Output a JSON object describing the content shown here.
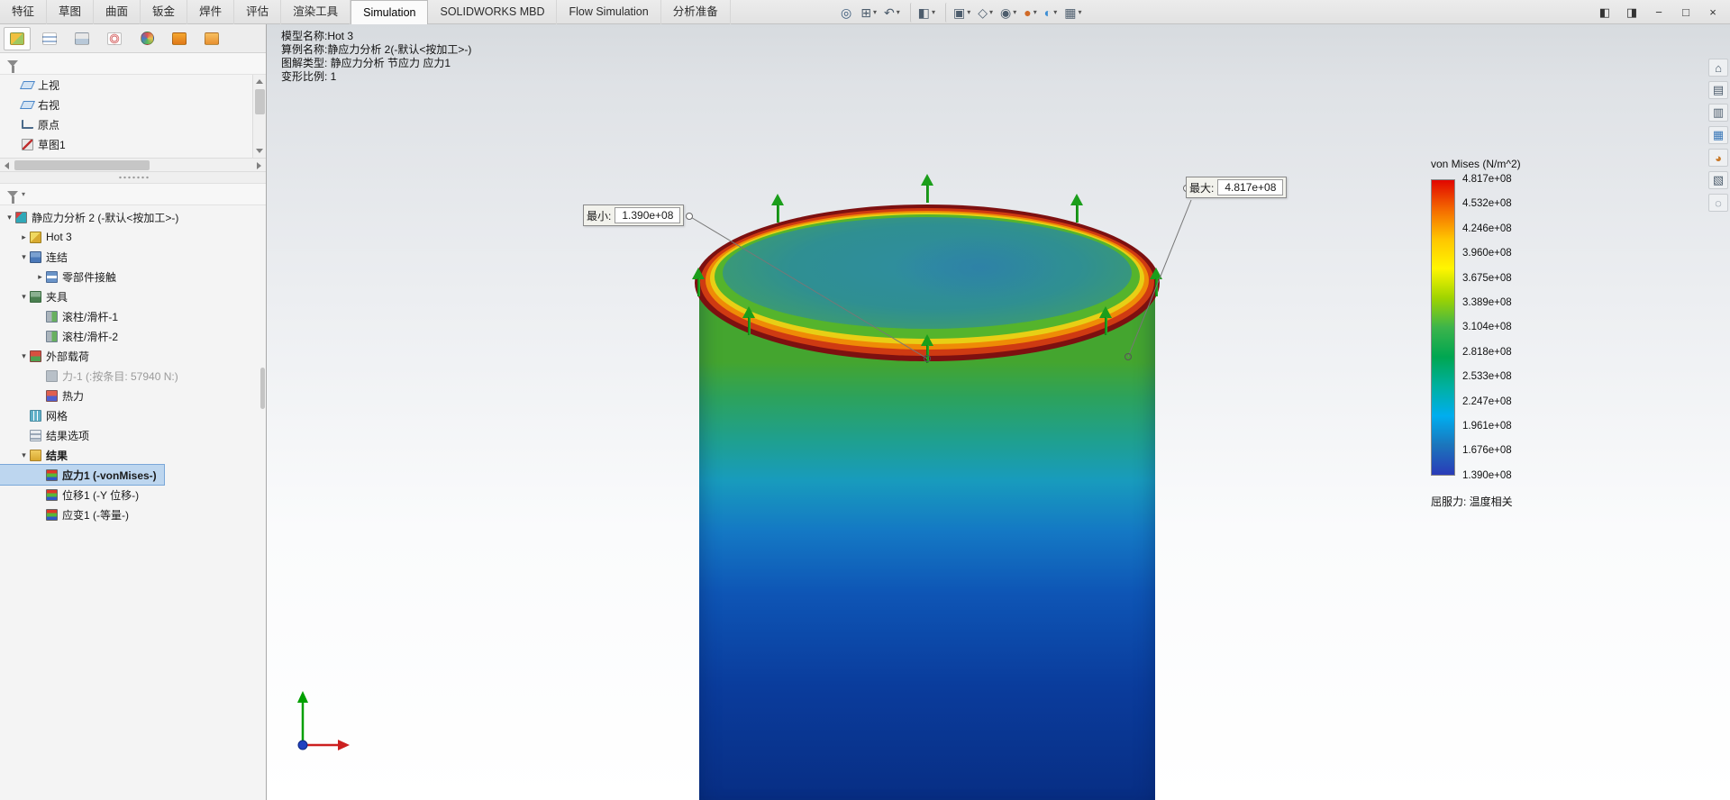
{
  "window": {
    "controls": [
      {
        "name": "task-pane-collapse-icon",
        "glyph": "◧"
      },
      {
        "name": "task-pane-expand-icon",
        "glyph": "◨"
      },
      {
        "name": "minimize-button",
        "glyph": "−"
      },
      {
        "name": "maximize-button",
        "glyph": "□"
      },
      {
        "name": "close-button",
        "glyph": "×"
      }
    ]
  },
  "menu": {
    "tabs": [
      {
        "label": "特征",
        "active": false
      },
      {
        "label": "草图",
        "active": false
      },
      {
        "label": "曲面",
        "active": false
      },
      {
        "label": "钣金",
        "active": false
      },
      {
        "label": "焊件",
        "active": false
      },
      {
        "label": "评估",
        "active": false
      },
      {
        "label": "渲染工具",
        "active": false
      },
      {
        "label": "Simulation",
        "active": true
      },
      {
        "label": "SOLIDWORKS MBD",
        "active": false
      },
      {
        "label": "Flow Simulation",
        "active": false
      },
      {
        "label": "分析准备",
        "active": false
      }
    ]
  },
  "toolbar": {
    "icons": [
      {
        "name": "zoom-fit-icon",
        "glyph": "◎",
        "caret": "",
        "divider": false
      },
      {
        "name": "zoom-area-icon",
        "glyph": "⊞",
        "caret": "▾",
        "divider": false
      },
      {
        "name": "previous-view-icon",
        "glyph": "↶",
        "caret": "▾",
        "divider": false
      },
      {
        "name": "section-view-icon",
        "glyph": "◧",
        "caret": "▾",
        "divider": true
      },
      {
        "name": "view-orientation-icon",
        "glyph": "▣",
        "caret": "▾",
        "divider": true
      },
      {
        "name": "display-style-icon",
        "glyph": "◇",
        "caret": "▾",
        "divider": false
      },
      {
        "name": "hide-show-icon",
        "glyph": "◉",
        "caret": "▾",
        "divider": false
      },
      {
        "name": "edit-appearance-icon",
        "glyph": "●",
        "caret": "▾",
        "divider": false
      },
      {
        "name": "apply-scene-icon",
        "glyph": "◐",
        "caret": "▾",
        "divider": false
      },
      {
        "name": "view-settings-icon",
        "glyph": "▦",
        "caret": "▾",
        "divider": false
      }
    ]
  },
  "left_panel": {
    "tabs": [
      {
        "name": "featuremanager-tab",
        "active": true
      },
      {
        "name": "propertymanager-tab",
        "active": false
      },
      {
        "name": "configurationmanager-tab",
        "active": false
      },
      {
        "name": "dimxpertmanager-tab",
        "active": false
      },
      {
        "name": "displaymanager-tab",
        "active": false
      },
      {
        "name": "simulation-study-tab",
        "active": false
      },
      {
        "name": "motion-study-tab",
        "active": false
      }
    ],
    "overflow_glyph": "›",
    "feature_tree": [
      {
        "label": "上视",
        "icon": "plane-icon"
      },
      {
        "label": "右视",
        "icon": "plane-icon"
      },
      {
        "label": "原点",
        "icon": "origin-icon"
      },
      {
        "label": "草图1",
        "icon": "sketch-icon"
      }
    ],
    "study_tree": [
      {
        "label": "静应力分析 2 (-默认<按加工>-)",
        "icon": "study-icon",
        "level": 0,
        "arrow": "▾",
        "selected": false,
        "dim": false,
        "bold": false
      },
      {
        "label": "Hot 3",
        "icon": "part-icon",
        "level": 1,
        "arrow": "▸",
        "selected": false,
        "dim": false,
        "bold": false
      },
      {
        "label": "连结",
        "icon": "connections-icon",
        "level": 1,
        "arrow": "▾",
        "selected": false,
        "dim": false,
        "bold": false
      },
      {
        "label": "零部件接触",
        "icon": "contact-icon",
        "level": 2,
        "arrow": "▸",
        "selected": false,
        "dim": false,
        "bold": false
      },
      {
        "label": "夹具",
        "icon": "fixtures-icon",
        "level": 1,
        "arrow": "▾",
        "selected": false,
        "dim": false,
        "bold": false
      },
      {
        "label": "滚柱/滑杆-1",
        "icon": "roller-icon",
        "level": 2,
        "arrow": "",
        "selected": false,
        "dim": false,
        "bold": false
      },
      {
        "label": "滚柱/滑杆-2",
        "icon": "roller-icon",
        "level": 2,
        "arrow": "",
        "selected": false,
        "dim": false,
        "bold": false
      },
      {
        "label": "外部载荷",
        "icon": "loads-icon",
        "level": 1,
        "arrow": "▾",
        "selected": false,
        "dim": false,
        "bold": false
      },
      {
        "label": "力-1 (:按条目: 57940 N:)",
        "icon": "force-icon",
        "level": 2,
        "arrow": "",
        "selected": false,
        "dim": true,
        "bold": false
      },
      {
        "label": "热力",
        "icon": "thermal-icon",
        "level": 2,
        "arrow": "",
        "selected": false,
        "dim": false,
        "bold": false
      },
      {
        "label": "网格",
        "icon": "mesh-icon",
        "level": 1,
        "arrow": "",
        "selected": false,
        "dim": false,
        "bold": false
      },
      {
        "label": "结果选项",
        "icon": "result-options-icon",
        "level": 1,
        "arrow": "",
        "selected": false,
        "dim": false,
        "bold": false
      },
      {
        "label": "结果",
        "icon": "results-folder-icon",
        "level": 1,
        "arrow": "▾",
        "selected": false,
        "dim": false,
        "bold": true
      },
      {
        "label": "应力1 (-vonMises-)",
        "icon": "stress-plot-icon",
        "level": 2,
        "arrow": "",
        "selected": true,
        "dim": false,
        "bold": false
      },
      {
        "label": "位移1 (-Y 位移-)",
        "icon": "displacement-plot-icon",
        "level": 2,
        "arrow": "",
        "selected": false,
        "dim": false,
        "bold": false
      },
      {
        "label": "应变1 (-等量-)",
        "icon": "strain-plot-icon",
        "level": 2,
        "arrow": "",
        "selected": false,
        "dim": false,
        "bold": false
      }
    ]
  },
  "viewport": {
    "info_lines": [
      "模型名称:Hot 3",
      "算例名称:静应力分析 2(-默认<按加工>-)",
      "图解类型: 静应力分析 节应力 应力1",
      "变形比例: 1"
    ],
    "callouts": {
      "min": {
        "label": "最小:",
        "value": "1.390e+08"
      },
      "max": {
        "label": "最大:",
        "value": "4.817e+08"
      }
    }
  },
  "legend": {
    "title": "von Mises (N/m^2)",
    "values": [
      "4.817e+08",
      "4.532e+08",
      "4.246e+08",
      "3.960e+08",
      "3.675e+08",
      "3.389e+08",
      "3.104e+08",
      "2.818e+08",
      "2.533e+08",
      "2.247e+08",
      "1.961e+08",
      "1.676e+08",
      "1.390e+08"
    ],
    "footer": "屈服力: 温度相关",
    "colors_top_to_bottom": [
      "#e10600",
      "#f46a00",
      "#ffc500",
      "#fff600",
      "#9fd400",
      "#3cb44b",
      "#00a651",
      "#00b0a0",
      "#00aeef",
      "#1b75bc",
      "#2a3bb8"
    ]
  },
  "right_toolbar": {
    "icons": [
      {
        "name": "resources-icon",
        "glyph": "⌂"
      },
      {
        "name": "design-library-icon",
        "glyph": "▤"
      },
      {
        "name": "file-explorer-icon",
        "glyph": "▥"
      },
      {
        "name": "view-palette-icon",
        "glyph": "▦"
      },
      {
        "name": "appearances-scenes-icon",
        "glyph": "◕"
      },
      {
        "name": "custom-properties-icon",
        "glyph": "▧"
      },
      {
        "name": "forum-icon",
        "glyph": "◌"
      }
    ]
  }
}
